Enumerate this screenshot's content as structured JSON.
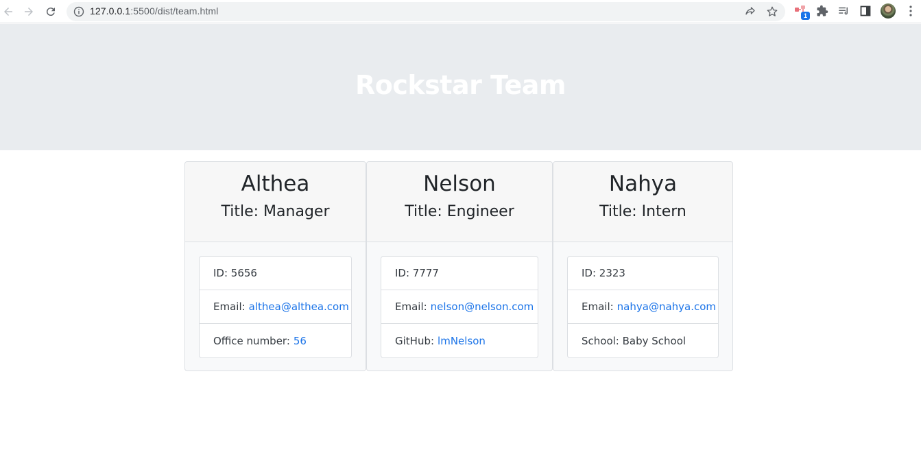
{
  "browser": {
    "url_host": "127.0.0.1",
    "url_path": ":5500/dist/team.html",
    "extension_badge": "1"
  },
  "page": {
    "title": "Rockstar Team"
  },
  "cards": [
    {
      "name": "Althea",
      "role": "Title: Manager",
      "id_label": "ID: 5656",
      "email_label": "Email:",
      "email": "althea@althea.com",
      "extra_label": "Office number:",
      "extra_value": "56"
    },
    {
      "name": "Nelson",
      "role": "Title: Engineer",
      "id_label": "ID: 7777",
      "email_label": "Email:",
      "email": "nelson@nelson.com",
      "extra_label": "GitHub:",
      "extra_value": "lmNelson"
    },
    {
      "name": "Nahya",
      "role": "Title: Intern",
      "id_label": "ID: 2323",
      "email_label": "Email:",
      "email": "nahya@nahya.com",
      "extra_label": "School: Baby School",
      "extra_value": ""
    }
  ],
  "colors": {
    "header_bg": "#e9ecef",
    "link": "#1a73e8",
    "card_bg": "#f8f9fa"
  }
}
